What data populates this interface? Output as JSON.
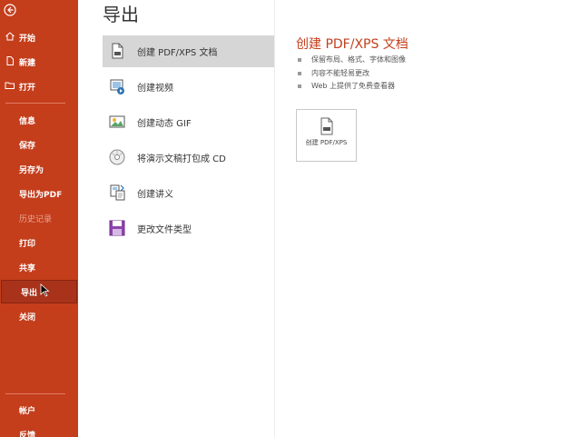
{
  "nav": {
    "back_label": "",
    "items_top": [
      {
        "label": "开始",
        "icon": "home-icon"
      },
      {
        "label": "新建",
        "icon": "new-file-icon"
      },
      {
        "label": "打开",
        "icon": "open-folder-icon"
      }
    ],
    "items_mid": [
      {
        "label": "信息"
      },
      {
        "label": "保存"
      },
      {
        "label": "另存为"
      },
      {
        "label": "导出为PDF"
      },
      {
        "label": "历史记录",
        "disabled": true
      },
      {
        "label": "打印"
      },
      {
        "label": "共享"
      },
      {
        "label": "导出",
        "selected": true
      },
      {
        "label": "关闭"
      }
    ],
    "items_bottom": [
      {
        "label": "帐户"
      },
      {
        "label": "反馈"
      }
    ]
  },
  "page": {
    "title": "导出"
  },
  "options": [
    {
      "label": "创建 PDF/XPS 文档",
      "icon": "pdf-document-icon",
      "selected": true
    },
    {
      "label": "创建视频",
      "icon": "video-icon"
    },
    {
      "label": "创建动态 GIF",
      "icon": "gif-image-icon"
    },
    {
      "label": "将演示文稿打包成 CD",
      "icon": "cd-disc-icon"
    },
    {
      "label": "创建讲义",
      "icon": "handout-icon"
    },
    {
      "label": "更改文件类型",
      "icon": "change-type-icon"
    }
  ],
  "detail": {
    "title": "创建 PDF/XPS 文档",
    "bullets": [
      "保留布局、格式、字体和图像",
      "内容不能轻易更改",
      "Web 上提供了免费查看器"
    ],
    "action_label": "创建 PDF/XPS"
  },
  "colors": {
    "accent": "#c43e1c",
    "nav_selected": "#a8321a"
  }
}
